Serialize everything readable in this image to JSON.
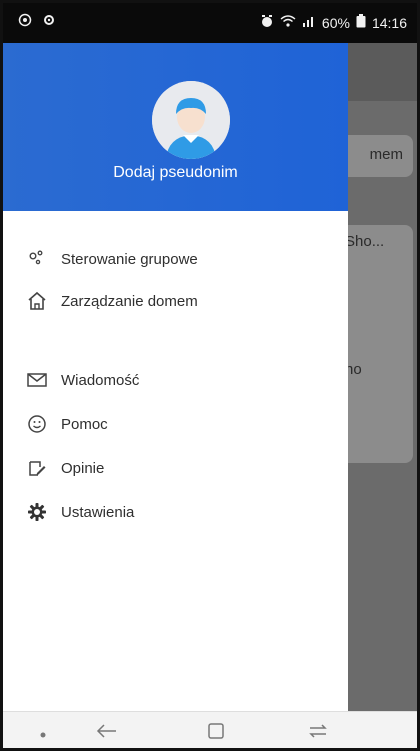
{
  "status_bar": {
    "battery_percent": "60%",
    "time": "14:16"
  },
  "background_app": {
    "card_text": "mem",
    "card2_title": "Sho...",
    "card2_text": "no"
  },
  "drawer": {
    "nickname_label": "Dodaj pseudonim",
    "items": [
      {
        "label": "Sterowanie grupowe",
        "icon": "group-control-icon"
      },
      {
        "label": "Zarządzanie domem",
        "icon": "home-icon"
      },
      {
        "label": "Wiadomość",
        "icon": "mail-icon"
      },
      {
        "label": "Pomoc",
        "icon": "smiley-help-icon"
      },
      {
        "label": "Opinie",
        "icon": "feedback-icon"
      },
      {
        "label": "Ustawienia",
        "icon": "gear-icon"
      }
    ]
  },
  "colors": {
    "drawer_header": "#1f63d7",
    "overlay": "#6b6b6b",
    "nav_bar": "#f3f3f3"
  }
}
